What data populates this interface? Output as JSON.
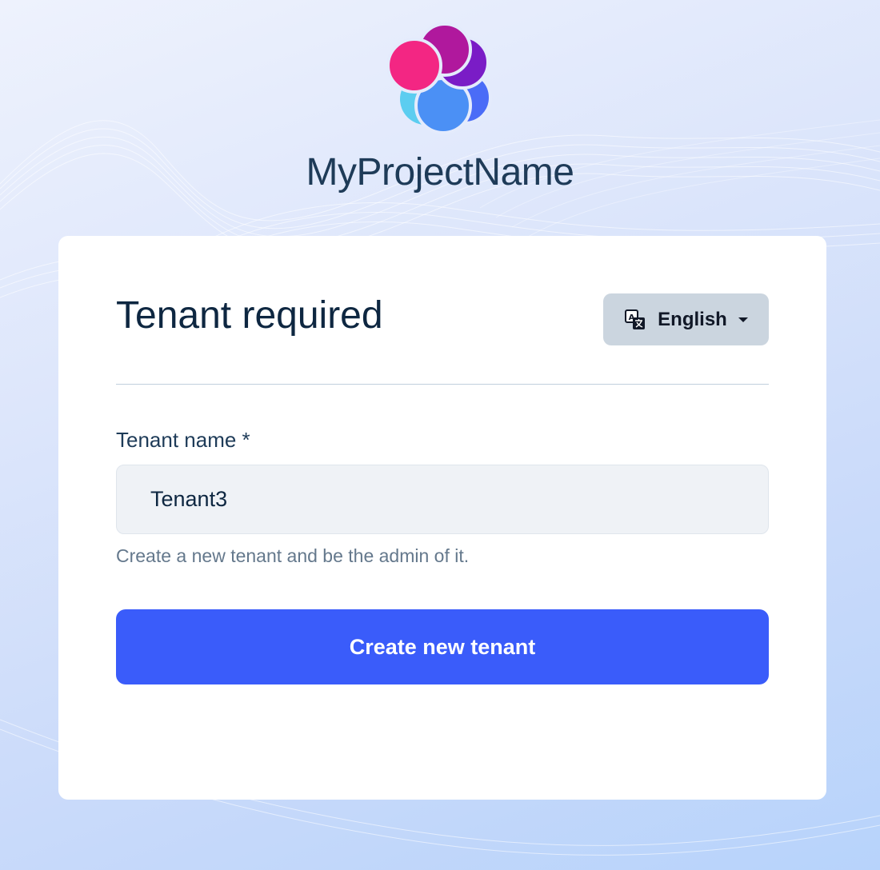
{
  "brand": {
    "name": "MyProjectName",
    "logo_icon": "flower-logo-icon"
  },
  "card": {
    "title": "Tenant required",
    "language": {
      "icon": "translate-icon",
      "label": "English",
      "caret_icon": "caret-down-icon"
    },
    "form": {
      "tenant_name_label": "Tenant name *",
      "tenant_name_value": "Tenant3",
      "help_text": "Create a new tenant and be the admin of it.",
      "submit_label": "Create new tenant"
    }
  },
  "colors": {
    "primary_button": "#3a5cfa",
    "title_text": "#0e2741",
    "language_button": "#cbd5df"
  }
}
